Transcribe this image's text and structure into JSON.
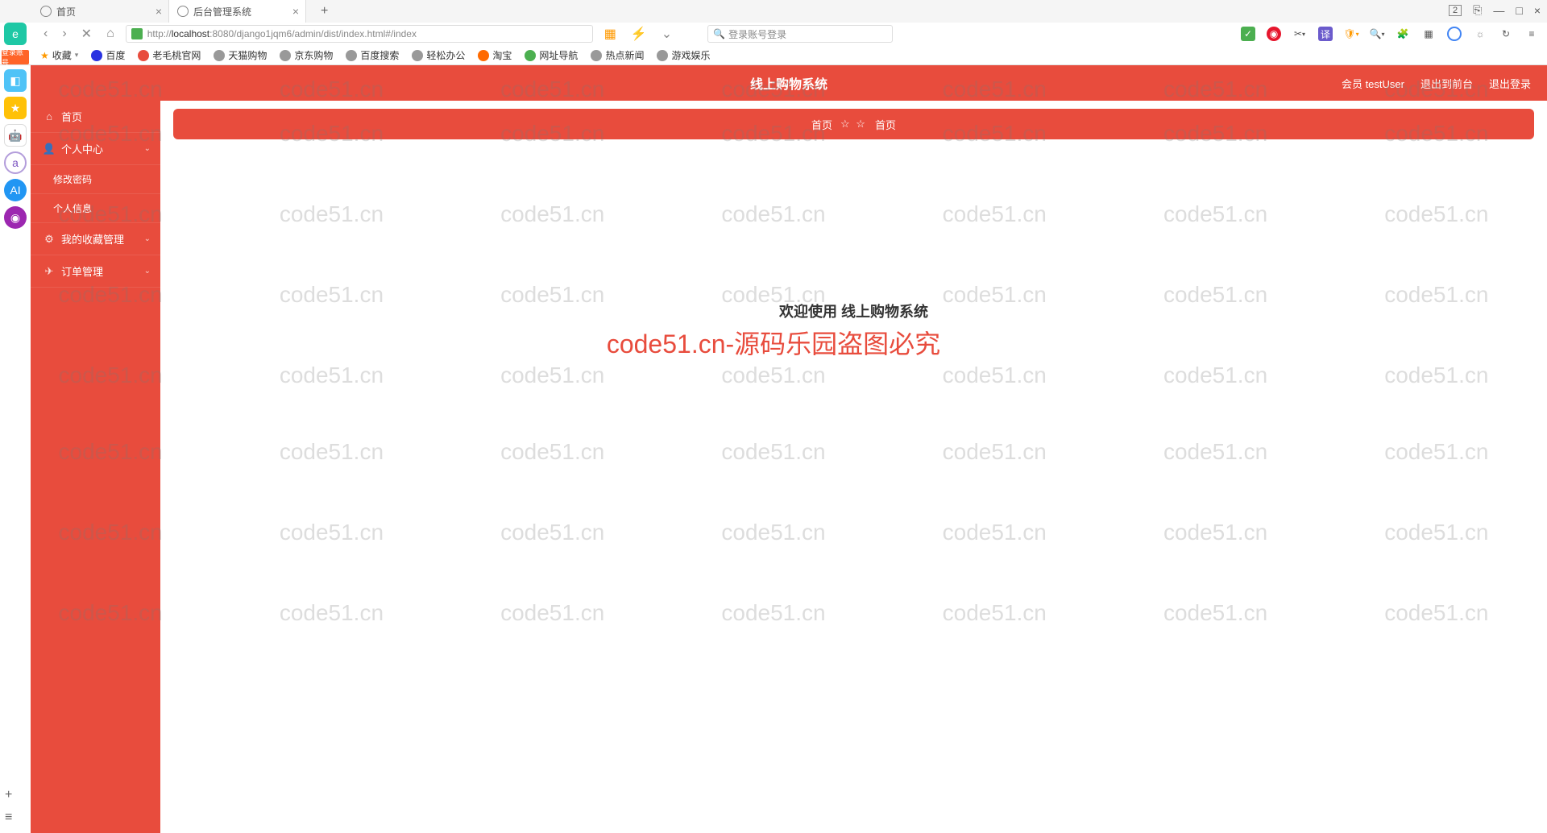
{
  "browser": {
    "tabs": [
      {
        "title": "首页"
      },
      {
        "title": "后台管理系统"
      }
    ],
    "window_badge": "2",
    "url_prefix": "http://",
    "url_host": "localhost",
    "url_path": ":8080/django1jqm6/admin/dist/index.html#/index",
    "search_placeholder": "登录账号登录",
    "bookmarks": {
      "fav": "收藏",
      "baidu": "百度",
      "laomaotao": "老毛桃官网",
      "tmall": "天猫购物",
      "jd": "京东购物",
      "baidusearch": "百度搜索",
      "qingsong": "轻松办公",
      "taobao": "淘宝",
      "wangzhi": "网址导航",
      "hotnews": "热点新闻",
      "youxi": "游戏娱乐"
    }
  },
  "left_icons": {
    "login": "登录账号"
  },
  "app": {
    "title": "线上购物系统",
    "user_label": "会员 testUser",
    "exit_to_front": "退出到前台",
    "logout": "退出登录"
  },
  "sidebar": {
    "home": "首页",
    "personal": "个人中心",
    "change_pwd": "修改密码",
    "personal_info": "个人信息",
    "favorites": "我的收藏管理",
    "orders": "订单管理"
  },
  "breadcrumb": {
    "left": "首页",
    "stars": "☆ ☆",
    "right": "首页"
  },
  "welcome": "欢迎使用 线上购物系统",
  "watermark_text": "code51.cn",
  "watermark_red": "code51.cn-源码乐园盗图必究"
}
